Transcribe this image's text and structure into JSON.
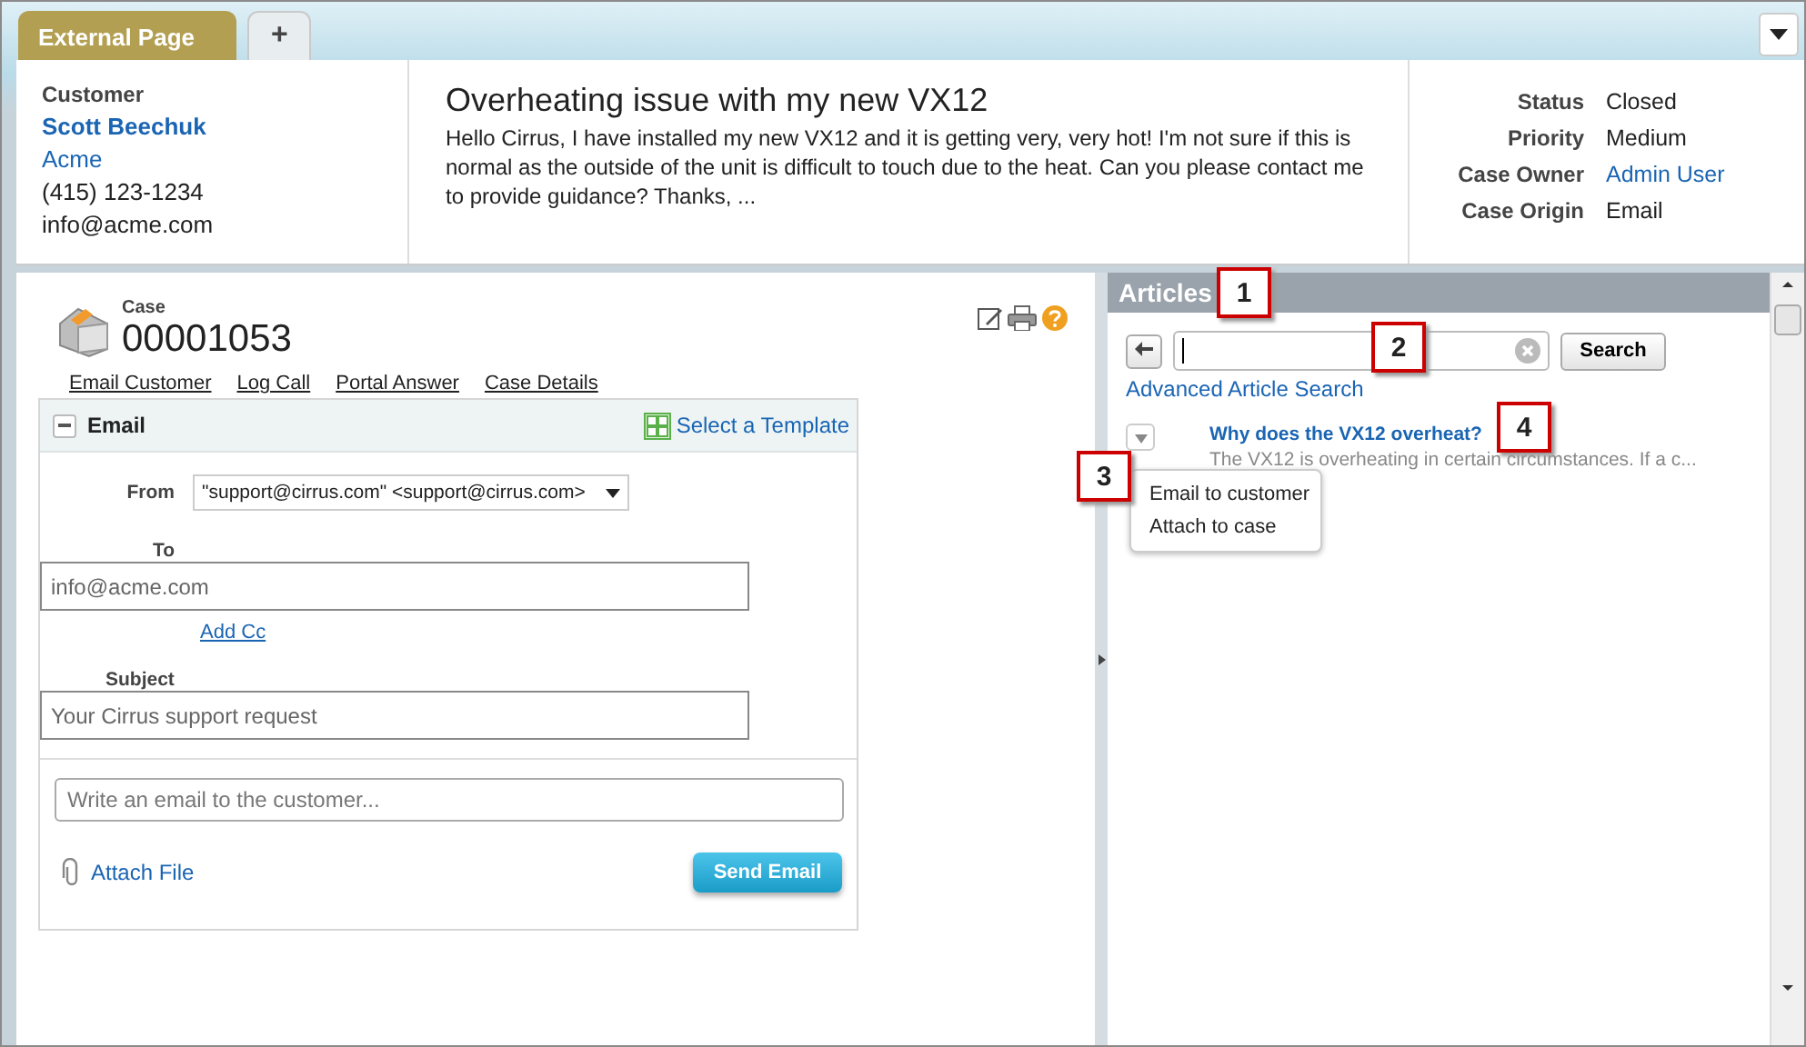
{
  "tabs": [
    {
      "label": "External Page",
      "selected": true
    },
    {
      "label": "+",
      "selected": false
    }
  ],
  "customer": {
    "heading": "Customer",
    "name": "Scott Beechuk",
    "company": "Acme",
    "phone": "(415) 123-1234",
    "email": "info@acme.com"
  },
  "case_summary": {
    "subject": "Overheating issue with my new VX12",
    "description": "Hello Cirrus, I have installed my new VX12 and it is getting very, very hot! I'm not sure if this is normal as the outside of the unit is difficult to touch due to the heat. Can you please contact me to provide guidance? Thanks, ..."
  },
  "case_fields": [
    {
      "label": "Status",
      "value": "Closed",
      "kind": "text"
    },
    {
      "label": "Priority",
      "value": "Medium",
      "kind": "text"
    },
    {
      "label": "Case Owner",
      "value": "Admin User",
      "kind": "link"
    },
    {
      "label": "Case Origin",
      "value": "Email",
      "kind": "text"
    }
  ],
  "case": {
    "label": "Case",
    "number": "00001053"
  },
  "actions": [
    "Email Customer",
    "Log Call",
    "Portal Answer",
    "Case Details"
  ],
  "email": {
    "title": "Email",
    "template_link": "Select a Template",
    "from_label": "From",
    "from_value": "\"support@cirrus.com\" <support@cirrus.com>",
    "to_label": "To",
    "to_value": "info@acme.com",
    "add_cc": "Add Cc",
    "subject_label": "Subject",
    "subject_value": "Your Cirrus support request",
    "body_placeholder": "Write an email to the customer...",
    "attach": "Attach File",
    "send": "Send Email"
  },
  "articles": {
    "title": "Articles",
    "search_button": "Search",
    "advanced_link": "Advanced Article Search",
    "results": [
      {
        "title": "Why does the VX12 overheat?",
        "summary": "The VX12 is overheating in certain circumstances. If a c..."
      }
    ],
    "menu": [
      "Email to customer",
      "Attach to case"
    ]
  },
  "callouts": [
    "1",
    "2",
    "3",
    "4"
  ]
}
